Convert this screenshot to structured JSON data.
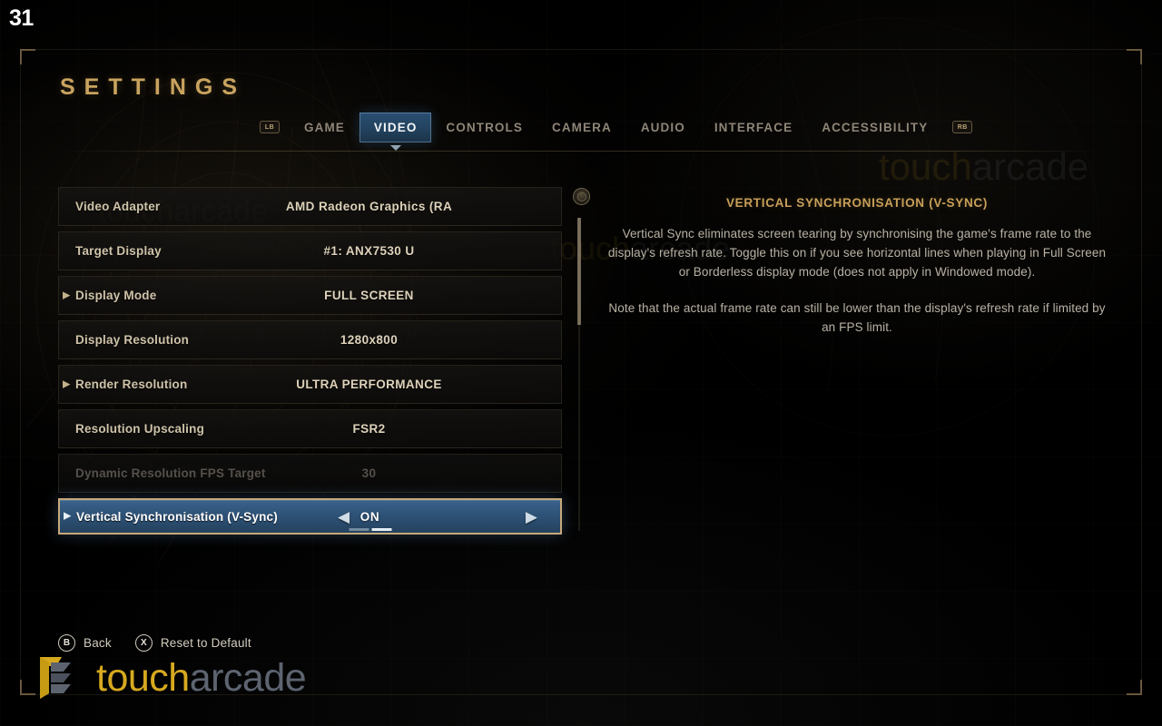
{
  "overlay": {
    "fps": "31"
  },
  "header": {
    "title": "SETTINGS"
  },
  "tabs": {
    "left_bumper": "LB",
    "right_bumper": "RB",
    "items": [
      {
        "label": "GAME",
        "active": false
      },
      {
        "label": "VIDEO",
        "active": true
      },
      {
        "label": "CONTROLS",
        "active": false
      },
      {
        "label": "CAMERA",
        "active": false
      },
      {
        "label": "AUDIO",
        "active": false
      },
      {
        "label": "INTERFACE",
        "active": false
      },
      {
        "label": "ACCESSIBILITY",
        "active": false
      }
    ]
  },
  "settings": {
    "rows": [
      {
        "label": "Video Adapter",
        "value": "AMD Radeon Graphics (RA",
        "expandable": false,
        "disabled": false,
        "selected": false
      },
      {
        "label": "Target Display",
        "value": "#1: ANX7530 U",
        "expandable": false,
        "disabled": false,
        "selected": false
      },
      {
        "label": "Display Mode",
        "value": "FULL SCREEN",
        "expandable": true,
        "disabled": false,
        "selected": false
      },
      {
        "label": "Display Resolution",
        "value": "1280x800",
        "expandable": false,
        "disabled": false,
        "selected": false
      },
      {
        "label": "Render Resolution",
        "value": "ULTRA PERFORMANCE",
        "expandable": true,
        "disabled": false,
        "selected": false
      },
      {
        "label": "Resolution Upscaling",
        "value": "FSR2",
        "expandable": false,
        "disabled": false,
        "selected": false
      },
      {
        "label": "Dynamic Resolution FPS Target",
        "value": "30",
        "expandable": false,
        "disabled": true,
        "selected": false
      },
      {
        "label": "Vertical Synchronisation (V-Sync)",
        "value": "ON",
        "expandable": true,
        "disabled": false,
        "selected": true
      }
    ],
    "selected_nav": {
      "left_arrow": "◀",
      "right_arrow": "▶",
      "value": "ON",
      "option_count": 2,
      "option_index": 2
    },
    "expand_arrow": "▶",
    "stick_icon": "right-stick-icon"
  },
  "description": {
    "title": "VERTICAL SYNCHRONISATION (V-SYNC)",
    "paragraphs": [
      "Vertical Sync eliminates screen tearing by synchronising the game's frame rate to the display's refresh rate. Toggle this on if you see horizontal lines when playing in Full Screen or Borderless display mode (does not apply in Windowed mode).",
      "Note that the actual frame rate can still be lower than the display's refresh rate if limited by an FPS limit."
    ]
  },
  "footer": {
    "buttons": [
      {
        "glyph": "B",
        "label": "Back"
      },
      {
        "glyph": "X",
        "label": "Reset to Default"
      }
    ]
  },
  "watermark": {
    "text_primary": "touch",
    "text_secondary": "arcade"
  },
  "colors": {
    "accent_gold": "#c9a35e",
    "selected_blue": "#2f5479",
    "selected_border": "#c6a978",
    "row_text": "#cfc3a9",
    "disabled_text": "#55504a",
    "desc_title": "#c79f59",
    "logo_gold": "#d7a91f",
    "logo_grey": "#5d6470"
  }
}
